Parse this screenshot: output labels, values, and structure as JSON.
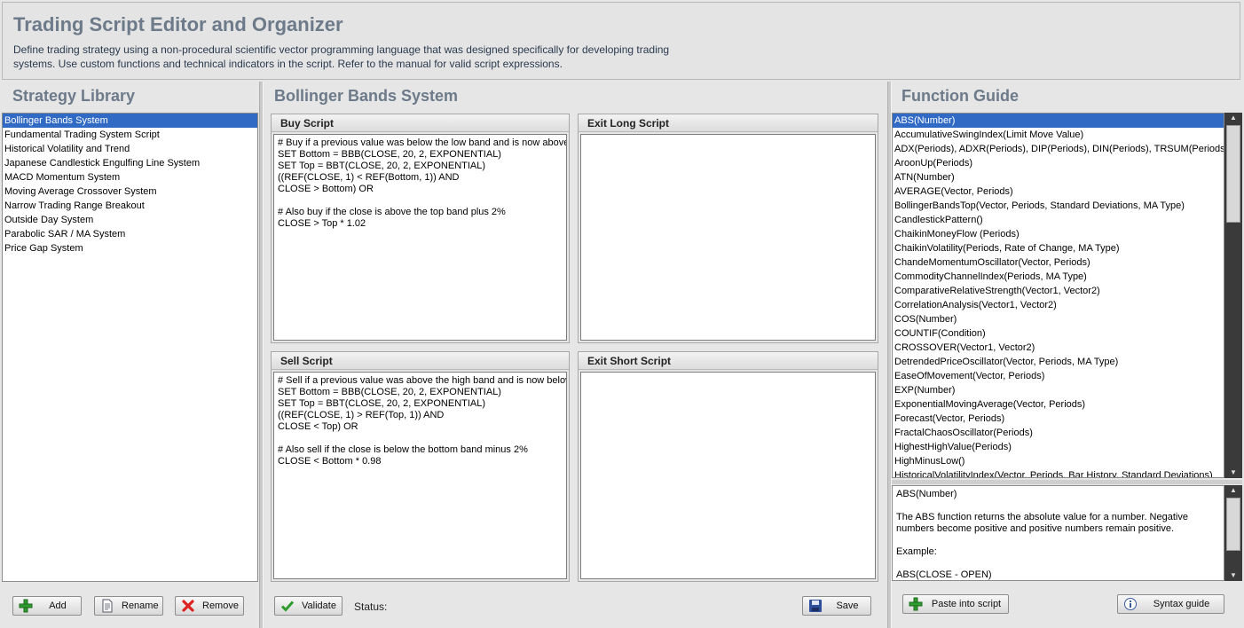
{
  "header": {
    "title": "Trading Script Editor and Organizer",
    "description": "Define trading strategy using a non-procedural scientific vector programming language that was designed specifically for developing trading systems. Use custom functions and technical indicators in the script. Refer to the manual for valid script expressions."
  },
  "library": {
    "title": "Strategy Library",
    "items": [
      "Bollinger Bands System",
      "Fundamental Trading System Script",
      "Historical Volatility and Trend",
      "Japanese Candlestick Engulfing Line System",
      "MACD Momentum System",
      "Moving Average Crossover System",
      "Narrow Trading Range Breakout",
      "Outside Day System",
      "Parabolic SAR / MA System",
      "Price Gap System"
    ],
    "selected_index": 0,
    "buttons": {
      "add": "Add",
      "rename": "Rename",
      "remove": "Remove"
    }
  },
  "editor": {
    "title": "Bollinger Bands System",
    "buy": {
      "label": "Buy Script",
      "text": "# Buy if a previous value was below the low band and is now above\nSET Bottom = BBB(CLOSE, 20, 2, EXPONENTIAL)\nSET Top = BBT(CLOSE, 20, 2, EXPONENTIAL)\n((REF(CLOSE, 1) < REF(Bottom, 1)) AND\nCLOSE > Bottom) OR\n\n# Also buy if the close is above the top band plus 2%\nCLOSE > Top * 1.02"
    },
    "exit_long": {
      "label": "Exit Long Script",
      "text": ""
    },
    "sell": {
      "label": "Sell Script",
      "text": "# Sell if a previous value was above the high band and is now below\nSET Bottom = BBB(CLOSE, 20, 2, EXPONENTIAL)\nSET Top = BBT(CLOSE, 20, 2, EXPONENTIAL)\n((REF(CLOSE, 1) > REF(Top, 1)) AND\nCLOSE < Top) OR\n\n# Also sell if the close is below the bottom band minus 2%\nCLOSE < Bottom * 0.98"
    },
    "exit_short": {
      "label": "Exit Short Script",
      "text": ""
    },
    "validate_label": "Validate",
    "status_label": "Status:",
    "save_label": "Save"
  },
  "guide": {
    "title": "Function Guide",
    "functions": [
      "ABS(Number)",
      "AccumulativeSwingIndex(Limit Move Value)",
      "ADX(Periods), ADXR(Periods), DIP(Periods), DIN(Periods), TRSUM(Periods), DX(Periods)",
      "AroonUp(Periods)",
      "ATN(Number)",
      "AVERAGE(Vector, Periods)",
      "BollingerBandsTop(Vector, Periods, Standard Deviations, MA Type)",
      "CandlestickPattern()",
      "ChaikinMoneyFlow (Periods)",
      "ChaikinVolatility(Periods, Rate of Change, MA Type)",
      "ChandeMomentumOscillator(Vector, Periods)",
      "CommodityChannelIndex(Periods, MA Type)",
      "ComparativeRelativeStrength(Vector1, Vector2)",
      "CorrelationAnalysis(Vector1, Vector2)",
      "COS(Number)",
      "COUNTIF(Condition)",
      "CROSSOVER(Vector1, Vector2)",
      "DetrendedPriceOscillator(Vector, Periods, MA Type)",
      "EaseOfMovement(Vector, Periods)",
      "EXP(Number)",
      "ExponentialMovingAverage(Vector, Periods)",
      "Forecast(Vector, Periods)",
      "FractalChaosOscillator(Periods)",
      "HighestHighValue(Periods)",
      "HighMinusLow()",
      "HistoricalVolatilityIndex(Vector, Periods, Bar History, Standard Deviations)"
    ],
    "selected_index": 0,
    "help_text": "ABS(Number)\n\nThe ABS function returns the absolute value for a number. Negative numbers become positive and positive numbers remain positive.\n\nExample:\n\nABS(CLOSE - OPEN)",
    "paste_label": "Paste into script",
    "syntax_label": "Syntax guide"
  },
  "colors": {
    "selection": "#316ac5",
    "title": "#6c7a8a",
    "scrollbar": "#3a3a3a"
  },
  "icons": {
    "add": "plus-icon",
    "rename": "document-icon",
    "remove": "x-icon",
    "validate": "check-icon",
    "save": "floppy-icon",
    "paste": "plus-icon",
    "syntax": "info-icon"
  }
}
